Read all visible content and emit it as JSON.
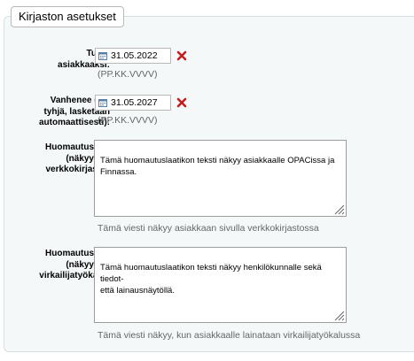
{
  "section": {
    "legend": "Kirjaston asetukset"
  },
  "fields": {
    "tullut": {
      "label_line1": "Tullut",
      "label_line2": "asiakkaaksi:",
      "value": "31.05.2022",
      "hint": "(PP.KK.VVVV)"
    },
    "vanhenee": {
      "label_line1": "Vanhenee (jos",
      "label_line2": "tyhjä, lasketaan",
      "label_line3": "automaattisesti):",
      "value": "31.05.2027",
      "hint": "(PP.KK.VVVV)"
    },
    "huomautus_opac": {
      "label_line1": "Huomautus",
      "label_line2": "(näkyy",
      "label_line3": "verkkokirjastossa",
      "value": "Tämä huomautuslaatikon teksti näkyy asiakkaalle OPACissa ja\nFinnassa.",
      "hint": "Tämä viesti näkyy asiakkaan sivulla verkkokirjastossa"
    },
    "huomautus_staff": {
      "label_line1": "Huomautus",
      "label_line2": "(näkyy",
      "label_line3": "virkailijatyökalussa",
      "value": "Tämä huomautuslaatikon teksti näkyy henkilökunnalle sekä tiedot-\nettä lainausnäytöllä.",
      "hint": "Tämä viesti näkyy, kun asiakkaalle lainataan virkailijatyökalussa"
    }
  },
  "icons": {
    "calendar": "calendar-icon",
    "clear": "clear-date-icon",
    "resize": "resize-grip-icon"
  },
  "colors": {
    "clear_icon": "#c41e1e",
    "calendar_icon": "#5a7ea6"
  }
}
